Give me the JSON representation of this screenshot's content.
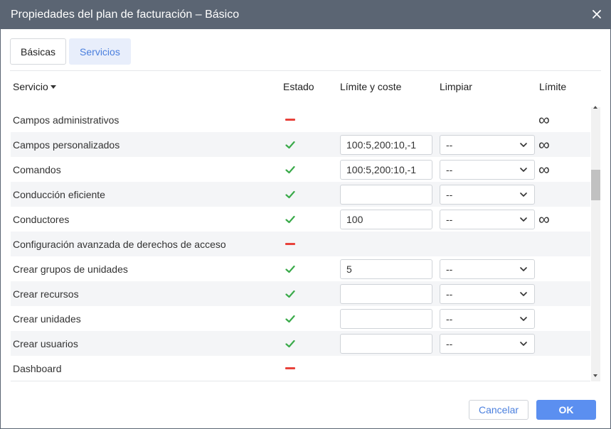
{
  "dialog": {
    "title": "Propiedades del plan de facturación – Básico",
    "close_icon": "close-icon"
  },
  "tabs": [
    {
      "label": "Básicas",
      "active": false
    },
    {
      "label": "Servicios",
      "active": true
    }
  ],
  "table": {
    "columns": {
      "service": "Servicio",
      "status": "Estado",
      "limit_cost": "Límite y coste",
      "reset": "Limpiar",
      "limit": "Límite"
    },
    "rows": [
      {
        "name": "Campos administrativos",
        "status": "disabled",
        "limit_value": null,
        "reset": null,
        "limit": "∞"
      },
      {
        "name": "Campos personalizados",
        "status": "enabled",
        "limit_value": "100:5,200:10,-1",
        "reset": "--",
        "limit": "∞"
      },
      {
        "name": "Comandos",
        "status": "enabled",
        "limit_value": "100:5,200:10,-1",
        "reset": "--",
        "limit": "∞"
      },
      {
        "name": "Conducción eficiente",
        "status": "enabled",
        "limit_value": "",
        "reset": "--",
        "limit": ""
      },
      {
        "name": "Conductores",
        "status": "enabled",
        "limit_value": "100",
        "reset": "--",
        "limit": "∞"
      },
      {
        "name": "Configuración avanzada de derechos de acceso",
        "status": "disabled",
        "limit_value": null,
        "reset": null,
        "limit": ""
      },
      {
        "name": "Crear grupos de unidades",
        "status": "enabled",
        "limit_value": "5",
        "reset": "--",
        "limit": ""
      },
      {
        "name": "Crear recursos",
        "status": "enabled",
        "limit_value": "",
        "reset": "--",
        "limit": ""
      },
      {
        "name": "Crear unidades",
        "status": "enabled",
        "limit_value": "",
        "reset": "--",
        "limit": ""
      },
      {
        "name": "Crear usuarios",
        "status": "enabled",
        "limit_value": "",
        "reset": "--",
        "limit": ""
      },
      {
        "name": "Dashboard",
        "status": "disabled",
        "limit_value": null,
        "reset": null,
        "limit": ""
      }
    ]
  },
  "footer": {
    "cancel_label": "Cancelar",
    "ok_label": "OK"
  },
  "colors": {
    "titlebar": "#5b6573",
    "accent": "#5b8ff0",
    "enabled": "#3aaa4a",
    "disabled": "#e8423b"
  }
}
